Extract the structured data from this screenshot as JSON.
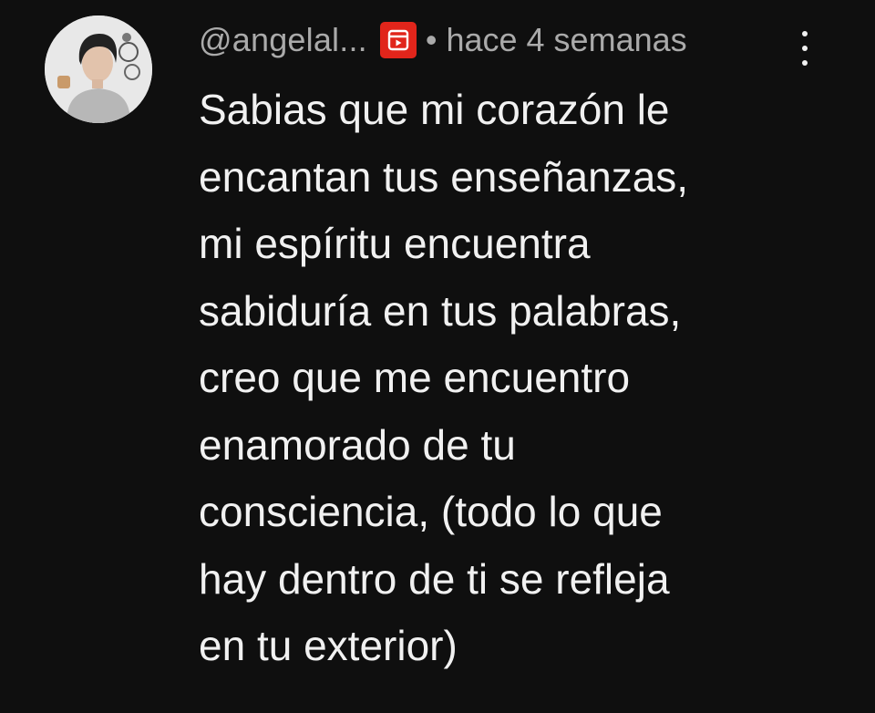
{
  "comment": {
    "author": "@angelal...",
    "separator": "•",
    "timestamp": "hace 4 semanas",
    "member_badge_icon": "youtube-member-badge-icon",
    "menu_icon": "more-vertical-icon",
    "body_lines": [
      "Sabias que mi corazón le",
      "encantan tus enseñanzas,",
      "mi espíritu encuentra",
      "sabiduría en tus palabras,",
      "creo que me encuentro",
      "enamorado de tu",
      "consciencia, (todo lo que",
      "hay dentro de ti se refleja",
      "en tu exterior)"
    ]
  },
  "colors": {
    "background": "#0f0f0f",
    "text_primary": "#f1f1f1",
    "text_secondary": "#aaaaaa",
    "badge": "#e1251b"
  }
}
